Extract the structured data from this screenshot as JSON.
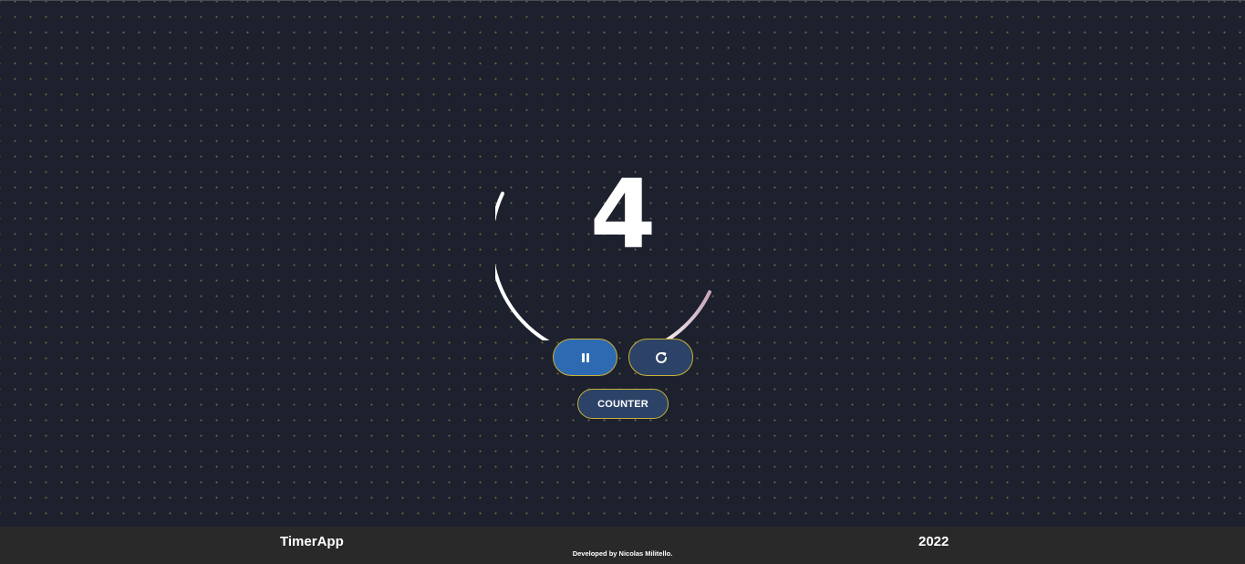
{
  "timer": {
    "value": "4",
    "progress_fraction": 0.4
  },
  "controls": {
    "pause_icon": "pause-icon",
    "reset_icon": "refresh-icon",
    "counter_label": "COUNTER"
  },
  "footer": {
    "brand": "TimerApp",
    "credit": "Developed by Nicolas Militello.",
    "year": "2022"
  },
  "colors": {
    "background": "#1d202d",
    "dot": "#b0a05a",
    "primary_button": "#2d6ab1",
    "secondary_button": "#2c4266",
    "button_border": "#c9b13a",
    "footer_background": "#292929",
    "arc": "#ffffff"
  }
}
